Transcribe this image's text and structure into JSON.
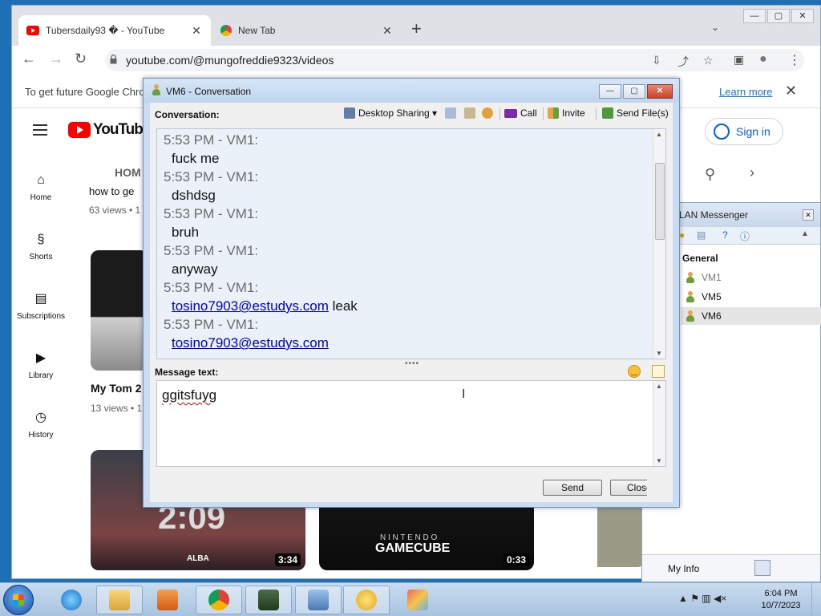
{
  "chrome": {
    "tabs": [
      {
        "title": "Tubersdaily93 � - YouTube",
        "close": "✕"
      },
      {
        "title": "New Tab",
        "close": "✕"
      }
    ],
    "new_tab": "+",
    "tabs_menu": "⌄",
    "window_controls": {
      "minimize": "—",
      "maximize": "▢",
      "close": "✕"
    },
    "nav": {
      "back": "←",
      "forward": "→",
      "reload": "↻"
    },
    "url": "youtube.com/@mungofreddie9323/videos",
    "toolbar_icons": {
      "install": "⇩",
      "share": "⤴",
      "bookmark": "☆",
      "sidebar": "▣",
      "profile": "●",
      "menu": "⋮"
    },
    "infobar": {
      "message": "To get future Google Chro",
      "learn_more": "Learn more",
      "close": "✕"
    }
  },
  "youtube": {
    "logo_text": "YouTube",
    "sign_in": "Sign in",
    "channel_tab": "HOM",
    "search_icon": "⚲",
    "next_icon": "›",
    "guide": [
      {
        "label": "Home",
        "icon": "⌂"
      },
      {
        "label": "Shorts",
        "icon": "§"
      },
      {
        "label": "Subscriptions",
        "icon": "▤"
      },
      {
        "label": "Library",
        "icon": "▶"
      },
      {
        "label": "History",
        "icon": "◷"
      }
    ],
    "videos": {
      "partial_title": "how to ge",
      "partial_views": "63 views • 1",
      "title2": "My Tom 2",
      "views2": "13 views • 1",
      "thumb_a_text": "2:09",
      "thumb_a_brand": "ALBA",
      "thumb_a_duration": "3:34",
      "thumb_b_brand_top": "N I N T E N D O",
      "thumb_b_brand": "GAMECUBE",
      "thumb_b_duration": "0:33"
    }
  },
  "conversation": {
    "title": "VM6 - Conversation",
    "window_controls": {
      "minimize": "—",
      "maximize": "▢",
      "close": "✕"
    },
    "label": "Conversation:",
    "toolbar": {
      "desktop_sharing": "Desktop Sharing ▾",
      "call": "Call",
      "invite": "Invite",
      "send_files": "Send File(s)"
    },
    "messages": [
      {
        "header": "5:53 PM - VM1:",
        "text": "fuck me",
        "link": "",
        "suffix": ""
      },
      {
        "header": "5:53 PM - VM1:",
        "text": "dshdsg",
        "link": "",
        "suffix": ""
      },
      {
        "header": "5:53 PM - VM1:",
        "text": "bruh",
        "link": "",
        "suffix": ""
      },
      {
        "header": "5:53 PM - VM1:",
        "text": "anyway",
        "link": "",
        "suffix": ""
      },
      {
        "header": "5:53 PM - VM1:",
        "text": "",
        "link": "tosino7903@estudys.com",
        "suffix": " leak"
      },
      {
        "header": "5:53 PM - VM1:",
        "text": "",
        "link": "tosino7903@estudys.com",
        "suffix": ""
      }
    ],
    "message_label": "Message text:",
    "message_value": "ggitsfuyg",
    "send_button": "Send",
    "close_button": "Close",
    "splitter": "••••"
  },
  "lan_messenger": {
    "title": "LAN Messenger",
    "group": "General",
    "contacts": [
      {
        "name": "VM1",
        "color": "#777777"
      },
      {
        "name": "VM5",
        "color": "#111111"
      },
      {
        "name": "VM6",
        "color": "#111111"
      }
    ],
    "my_info": "My Info"
  },
  "taskbar": {
    "time": "6:04 PM",
    "date": "10/7/2023",
    "tray": "▲ ⚑ ▥ ◀×"
  },
  "colors": {
    "desktop": "#1f6fb5",
    "link": "#0000cc",
    "youtube_red": "#ff0000",
    "sign_in_blue": "#065fd4"
  }
}
